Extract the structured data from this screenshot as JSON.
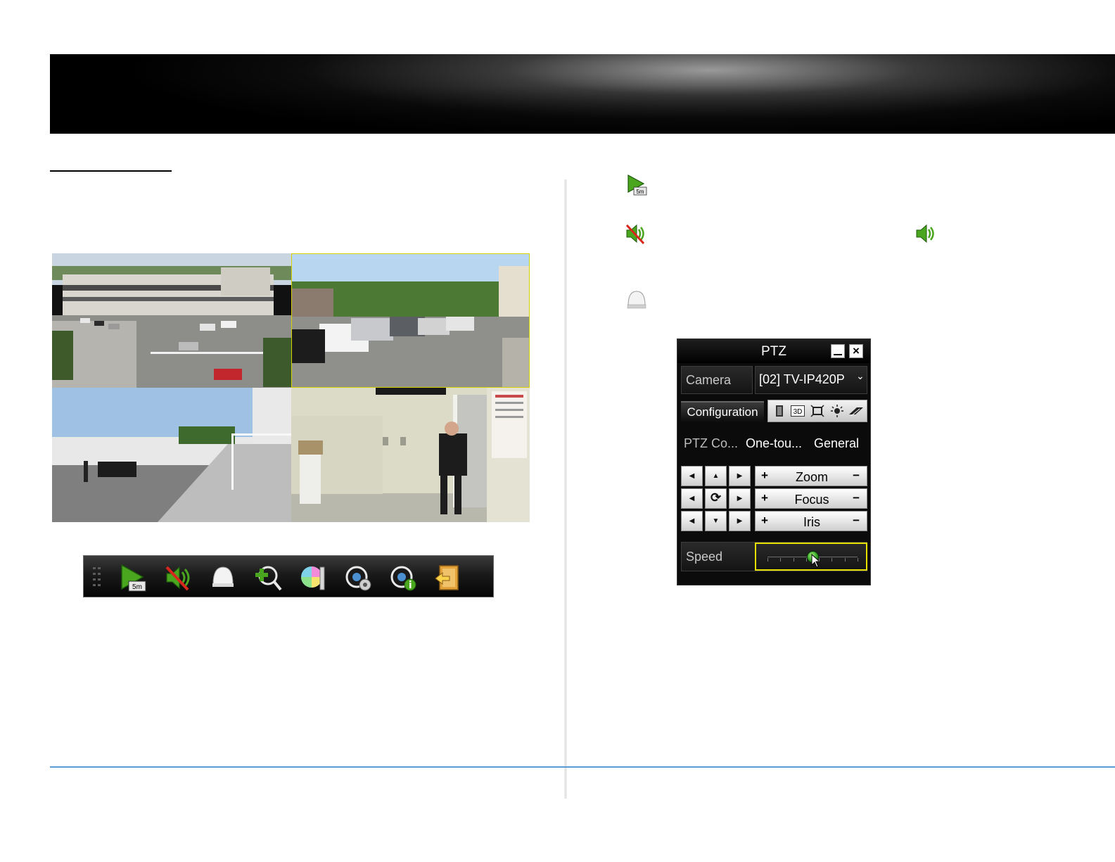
{
  "live_view_toolbar": {
    "buttons": [
      {
        "name": "instant-playback",
        "badge": "5m"
      },
      {
        "name": "mute"
      },
      {
        "name": "ptz-control"
      },
      {
        "name": "digital-zoom"
      },
      {
        "name": "image-settings"
      },
      {
        "name": "live-view-strategy"
      },
      {
        "name": "information"
      },
      {
        "name": "close-live-view"
      }
    ]
  },
  "legend": {
    "playback_badge": "5m"
  },
  "ptz_panel": {
    "title": "PTZ",
    "camera_label": "Camera",
    "camera_value": "[02] TV-IP420P",
    "configuration_label": "Configuration",
    "strip_3d_label": "3D",
    "tabs": [
      "PTZ Co...",
      "One-tou...",
      "General"
    ],
    "zoom_label": "Zoom",
    "focus_label": "Focus",
    "iris_label": "Iris",
    "plus": "+",
    "minus": "−",
    "speed_label": "Speed",
    "speed_value_fraction": 0.5
  },
  "colors": {
    "accent_blue": "#5b9bd5",
    "slider_border": "#e6e000",
    "play_green": "#4aa61e"
  }
}
